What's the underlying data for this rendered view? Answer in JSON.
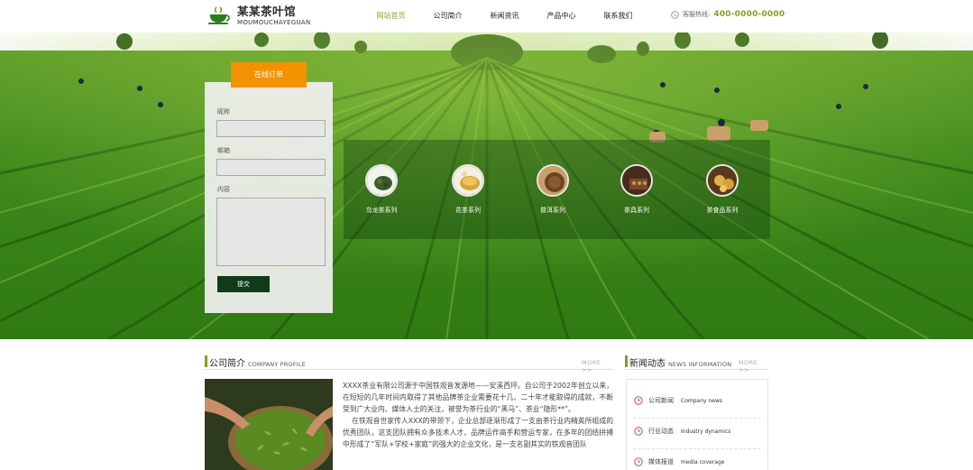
{
  "header": {
    "logo_name": "某某茶叶馆",
    "logo_sub": "MOUMOUCHAYEGUAN",
    "nav": [
      "网站首页",
      "公司简介",
      "新闻资讯",
      "产品中心",
      "联系我们"
    ],
    "hotline_label": "客服热线:",
    "hotline_number": "400-0000-0000"
  },
  "order_form": {
    "tab_label": "在线订单",
    "name_label": "昵称",
    "email_label": "邮箱",
    "content_label": "内容",
    "submit_label": "提交"
  },
  "categories": [
    "乌龙茶系列",
    "花茶系列",
    "普洱系列",
    "茶具系列",
    "茶食品系列"
  ],
  "profile": {
    "title": "公司简介",
    "title_en": "COMPANY PROFILE",
    "more": "MORE >>",
    "para1": "XXXX茶业有限公司源于中国铁观音发源地——安溪西坪。自公司于2002年创立以来，在短短的几年时间内取得了其他品牌茶企业需要花十几、二十年才能取得的成就，不断受到广大业内、媒体人士的关注，被誉为茶行业的“黑马”、茶业“隐形**”。",
    "para2": "在铁观音世家传人XXX的带领下，企业总部逐渐形成了一支由茶行业内精英所组成的优秀团队，这支团队拥有众多技术人才、品牌运作高手和营运专家，在多年的团结拼搏中形成了“军队+学校+家庭”的强大的企业文化，是一支名副其实的铁观音团队"
  },
  "news": {
    "title": "新闻动态",
    "title_en": "NEWS INFORMATION",
    "more": "MORE >>",
    "items": [
      {
        "label": "公司新闻",
        "en": "Company news"
      },
      {
        "label": "行业动态",
        "en": "Industry dynamics"
      },
      {
        "label": "媒体报道",
        "en": "media coverage"
      }
    ]
  },
  "colors": {
    "accent_green": "#7ea122",
    "order_orange": "#f39200",
    "submit_dark": "#103b1b"
  }
}
